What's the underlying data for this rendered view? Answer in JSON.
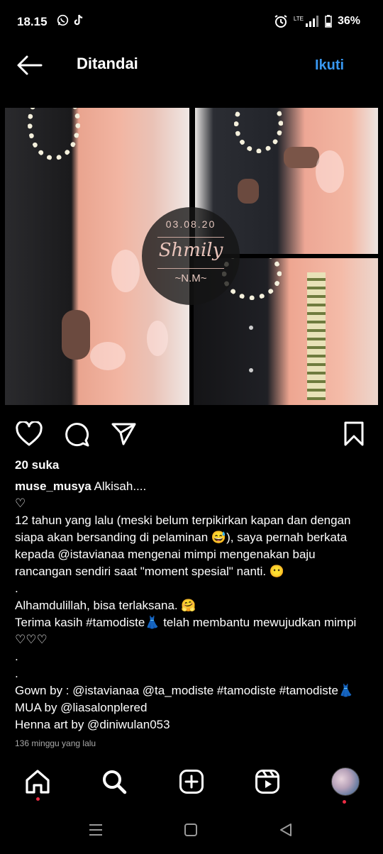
{
  "status_bar": {
    "time": "18.15",
    "network": "LTE",
    "battery": "36%",
    "icons": [
      "whatsapp-icon",
      "tiktok-icon",
      "alarm-icon",
      "signal-icon",
      "battery-icon"
    ]
  },
  "header": {
    "title": "Ditandai",
    "follow_label": "Ikuti",
    "accent_color": "#3897f0"
  },
  "photo": {
    "badge_date": "03.08.20",
    "badge_script": "Shmily",
    "badge_initials": "~N.M~"
  },
  "post": {
    "likes": "20 suka",
    "username": "muse_musya",
    "caption_first": " Alkisah....",
    "caption_lines": [
      "♡",
      "12 tahun yang lalu (meski belum terpikirkan kapan dan dengan siapa akan bersanding di pelaminan 😅), saya pernah berkata kepada @istavianaa mengenai mimpi mengenakan baju rancangan sendiri saat \"moment spesial\" nanti. 😶",
      ".",
      "Alhamdulillah, bisa terlaksana. 🤗",
      "Terima kasih #tamodiste👗 telah membantu mewujudkan mimpi ♡♡♡",
      ".",
      ".",
      "Gown by : @istavianaa @ta_modiste #tamodiste #tamodiste👗",
      "MUA by @liasalonplered",
      "Henna art by @diniwulan053"
    ],
    "time_ago": "136 minggu yang lalu"
  },
  "bottom_nav": {
    "items": [
      "home-icon",
      "search-icon",
      "create-icon",
      "reels-icon",
      "profile-avatar"
    ],
    "notification_color": "#ed2c44"
  },
  "system_nav": {
    "items": [
      "menu-icon",
      "home-square-icon",
      "back-triangle-icon"
    ]
  }
}
